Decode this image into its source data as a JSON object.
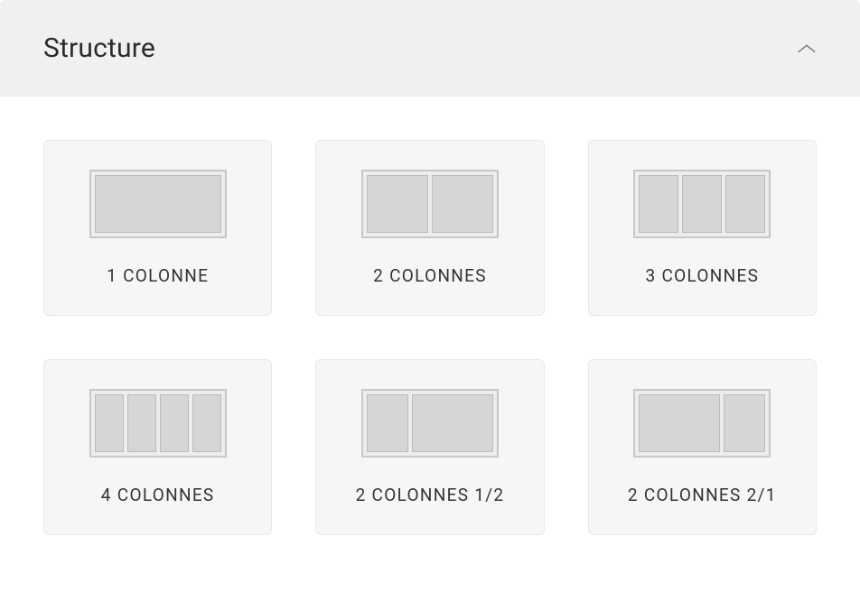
{
  "section": {
    "title": "Structure"
  },
  "options": [
    {
      "label": "1 COLONNE",
      "cols": [
        1
      ]
    },
    {
      "label": "2 COLONNES",
      "cols": [
        1,
        1
      ]
    },
    {
      "label": "3 COLONNES",
      "cols": [
        1,
        1,
        1
      ]
    },
    {
      "label": "4 COLONNES",
      "cols": [
        1,
        1,
        1,
        1
      ]
    },
    {
      "label": "2 COLONNES 1/2",
      "cols": [
        1,
        2
      ]
    },
    {
      "label": "2 COLONNES 2/1",
      "cols": [
        2,
        1
      ]
    }
  ]
}
